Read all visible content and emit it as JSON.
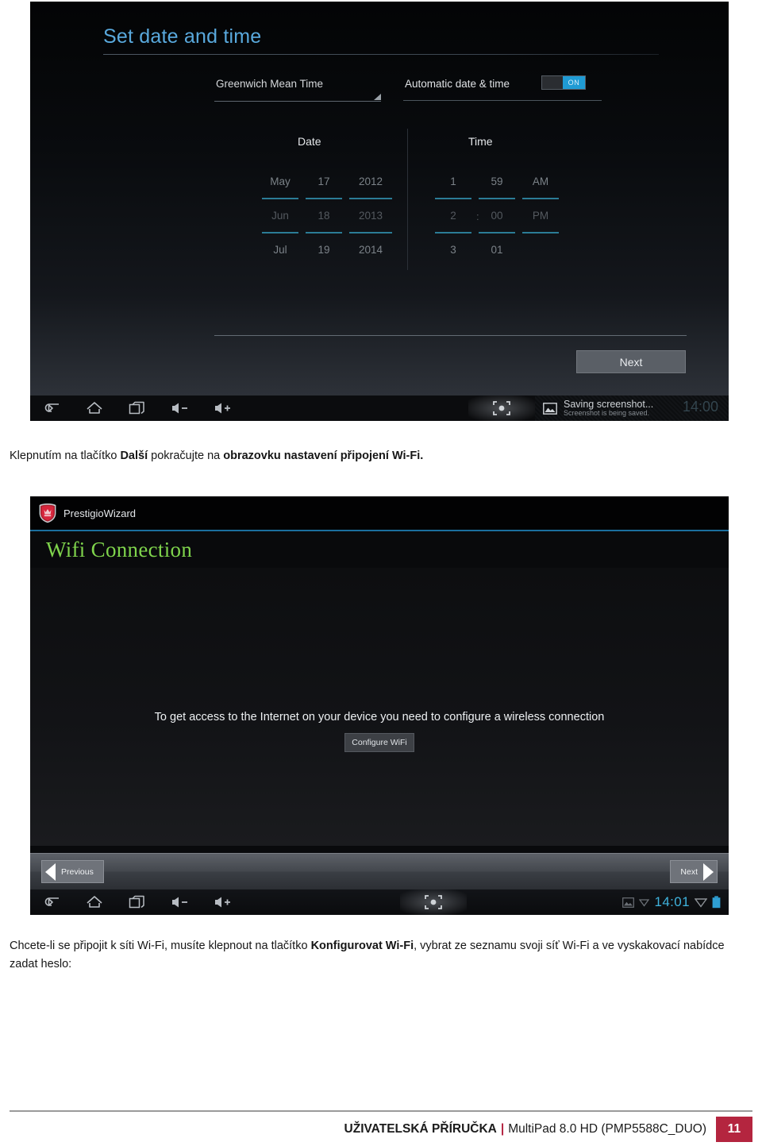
{
  "shot1": {
    "title": "Set date and time",
    "timezone_value": "Greenwich Mean Time",
    "automatic_label": "Automatic date & time",
    "toggle_state": "ON",
    "picker": {
      "date_header": "Date",
      "time_header": "Time",
      "month_wheel": [
        "May",
        "Jun",
        "Jul"
      ],
      "day_wheel": [
        "17",
        "18",
        "19"
      ],
      "year_wheel": [
        "2012",
        "2013",
        "2014"
      ],
      "hour_wheel": [
        "1",
        "2",
        "3"
      ],
      "minute_wheel": [
        "59",
        "00",
        "01"
      ],
      "meridiem_wheel": [
        "AM",
        "PM",
        ""
      ],
      "colon": ":"
    },
    "next_label": "Next",
    "toast": {
      "title": "Saving screenshot...",
      "subtitle": "Screenshot is being saved.",
      "icon": "image-icon",
      "clock": "14:00"
    },
    "navbar": {
      "back_icon": "back-arrow-icon",
      "home_icon": "home-icon",
      "recents_icon": "recent-apps-icon",
      "volume_down_icon": "volume-down-icon",
      "volume_up_icon": "volume-up-icon",
      "screenshot_icon": "screenshot-capture-icon"
    }
  },
  "caption1": {
    "part1": "Klepnutím na tlačítko ",
    "bold1": "Další",
    "part2": " pokračujte na ",
    "bold2": "obrazovku nastavení připojení Wi-Fi.",
    "part3": ""
  },
  "shot2": {
    "app_name": "PrestigioWizard",
    "app_icon": "prestigio-shield-logo-icon",
    "heading": "Wifi Connection",
    "description": "To get access to the Internet on your device you need to configure a wireless connection",
    "configure_button": "Configure WiFi",
    "previous_label": "Previous",
    "next_label": "Next",
    "status": {
      "image_icon": "image-icon",
      "wifi_small_icon": "wifi-small-icon",
      "clock": "14:01",
      "signal_icon": "wifi-signal-icon",
      "battery_icon": "battery-icon"
    },
    "navbar": {
      "back_icon": "back-arrow-icon",
      "home_icon": "home-icon",
      "recents_icon": "recent-apps-icon",
      "volume_down_icon": "volume-down-icon",
      "volume_up_icon": "volume-up-icon",
      "screenshot_icon": "screenshot-capture-icon"
    }
  },
  "caption2": {
    "part1": "Chcete-li se připojit k síti Wi-Fi, musíte klepnout na tlačítko ",
    "bold1": "Konfigurovat Wi-Fi",
    "part2": ", vybrat ze seznamu svoji síť Wi-Fi a ve vyskakovací nabídce zadat heslo:"
  },
  "footer": {
    "manual_label": "UŽIVATELSKÁ PŘÍRUČKA",
    "separator": "|",
    "device_label": "MultiPad 8.0 HD (PMP5588C_DUO)",
    "page_number": "11"
  },
  "colors": {
    "title_blue": "#59a9dd",
    "heading_green": "#7fd44c",
    "accent_red": "#b4253f",
    "toggle_on": "#1f9bd4",
    "clock_blue": "#3fb3dd"
  }
}
